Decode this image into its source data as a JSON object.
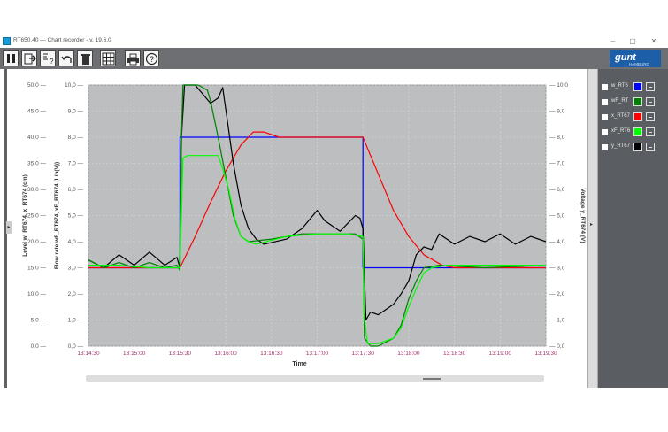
{
  "window": {
    "title": "RT650.40  —  Chart recorder - v. 19.6.0",
    "controls": [
      "minimize",
      "maximize",
      "close"
    ]
  },
  "toolbar": {
    "buttons": [
      "pause",
      "export",
      "settings-help",
      "undo",
      "delete",
      "grid",
      "print",
      "help"
    ],
    "logo_text": "gunt",
    "logo_subtext": "HAMBURG"
  },
  "legend": [
    {
      "label": "w_RT6",
      "color": "#0000ff"
    },
    {
      "label": "wF_RT",
      "color": "#008000"
    },
    {
      "label": "x_RT67",
      "color": "#ff0000"
    },
    {
      "label": "xF_RT6",
      "color": "#00ff00"
    },
    {
      "label": "y_RT67",
      "color": "#000000"
    }
  ],
  "chart_data": {
    "type": "line",
    "xlabel": "Time",
    "x_ticks": [
      "13:14:30",
      "13:15:00",
      "13:15:30",
      "13:16:00",
      "13:16:30",
      "13:17:00",
      "13:17:30",
      "13:18:00",
      "13:18:30",
      "13:19:00",
      "13:19:30"
    ],
    "x_range_seconds": [
      0,
      300
    ],
    "y_axes": [
      {
        "label": "Level  w_RT674, x_RT674   (cm)",
        "ticks": [
          "0,0",
          "5,0",
          "10,0",
          "15,0",
          "20,0",
          "25,0",
          "30,0",
          "35,0",
          "40,0",
          "45,0",
          "50,0"
        ],
        "range": [
          0,
          50
        ]
      },
      {
        "label": "Flow rate  wF_RT674, xF_RT674   (L/h(V))",
        "ticks": [
          "0,0",
          "1,0",
          "2,0",
          "3,0",
          "4,0",
          "5,0",
          "6,0",
          "7,0",
          "8,0",
          "9,0",
          "10,0"
        ],
        "range": [
          0,
          10
        ]
      },
      {
        "label": "Voltage  y_RT674   (V)",
        "ticks": [
          "0,0",
          "1,0",
          "2,0",
          "3,0",
          "4,0",
          "5,0",
          "6,0",
          "7,0",
          "8,0",
          "9,0",
          "10,0"
        ],
        "range": [
          0,
          10
        ]
      }
    ],
    "grid": true,
    "series": [
      {
        "name": "w_RT6",
        "color": "#0000ff",
        "points": [
          [
            0,
            3.0
          ],
          [
            60,
            3.0
          ],
          [
            60,
            8.0
          ],
          [
            180,
            8.0
          ],
          [
            180,
            3.0
          ],
          [
            300,
            3.0
          ]
        ]
      },
      {
        "name": "x_RT67",
        "color": "#ff0000",
        "points": [
          [
            0,
            3.0
          ],
          [
            60,
            3.0
          ],
          [
            70,
            4.2
          ],
          [
            80,
            5.5
          ],
          [
            90,
            6.7
          ],
          [
            100,
            7.7
          ],
          [
            108,
            8.2
          ],
          [
            115,
            8.2
          ],
          [
            125,
            8.0
          ],
          [
            180,
            8.0
          ],
          [
            190,
            6.6
          ],
          [
            200,
            5.2
          ],
          [
            210,
            4.2
          ],
          [
            220,
            3.5
          ],
          [
            232,
            3.1
          ],
          [
            240,
            3.0
          ],
          [
            300,
            3.0
          ]
        ]
      },
      {
        "name": "y_RT67",
        "color": "#000000",
        "points": [
          [
            0,
            3.3
          ],
          [
            10,
            3.0
          ],
          [
            20,
            3.5
          ],
          [
            30,
            3.1
          ],
          [
            40,
            3.6
          ],
          [
            50,
            3.1
          ],
          [
            58,
            3.4
          ],
          [
            60,
            3.0
          ],
          [
            61,
            8.0
          ],
          [
            63,
            10.0
          ],
          [
            70,
            10.0
          ],
          [
            80,
            9.3
          ],
          [
            85,
            9.5
          ],
          [
            88,
            9.9
          ],
          [
            95,
            7.0
          ],
          [
            100,
            5.4
          ],
          [
            105,
            4.5
          ],
          [
            110,
            4.1
          ],
          [
            115,
            3.9
          ],
          [
            130,
            4.1
          ],
          [
            140,
            4.5
          ],
          [
            150,
            5.2
          ],
          [
            155,
            4.8
          ],
          [
            160,
            4.6
          ],
          [
            165,
            4.4
          ],
          [
            170,
            4.7
          ],
          [
            175,
            5.0
          ],
          [
            178,
            4.9
          ],
          [
            180,
            4.5
          ],
          [
            182,
            1.0
          ],
          [
            185,
            1.3
          ],
          [
            190,
            1.2
          ],
          [
            195,
            1.4
          ],
          [
            200,
            1.6
          ],
          [
            205,
            2.0
          ],
          [
            210,
            2.5
          ],
          [
            215,
            3.5
          ],
          [
            220,
            3.8
          ],
          [
            225,
            3.7
          ],
          [
            230,
            4.3
          ],
          [
            240,
            3.9
          ],
          [
            250,
            4.2
          ],
          [
            260,
            4.0
          ],
          [
            270,
            4.3
          ],
          [
            280,
            3.9
          ],
          [
            290,
            4.2
          ],
          [
            300,
            4.0
          ]
        ]
      },
      {
        "name": "wF_RT",
        "color": "#008000",
        "points": [
          [
            0,
            3.3
          ],
          [
            10,
            3.0
          ],
          [
            20,
            3.2
          ],
          [
            30,
            3.0
          ],
          [
            40,
            3.2
          ],
          [
            50,
            3.0
          ],
          [
            58,
            3.1
          ],
          [
            60,
            2.9
          ],
          [
            61,
            8.0
          ],
          [
            62,
            10.0
          ],
          [
            72,
            10.0
          ],
          [
            78,
            9.8
          ],
          [
            80,
            9.4
          ],
          [
            85,
            8.0
          ],
          [
            90,
            6.5
          ],
          [
            95,
            5.0
          ],
          [
            100,
            4.2
          ],
          [
            105,
            4.0
          ],
          [
            120,
            4.1
          ],
          [
            140,
            4.3
          ],
          [
            160,
            4.3
          ],
          [
            175,
            4.3
          ],
          [
            180,
            4.1
          ],
          [
            181,
            0.3
          ],
          [
            185,
            0.0
          ],
          [
            190,
            0.0
          ],
          [
            200,
            0.3
          ],
          [
            205,
            0.8
          ],
          [
            210,
            1.8
          ],
          [
            215,
            2.5
          ],
          [
            220,
            3.0
          ],
          [
            230,
            3.1
          ],
          [
            260,
            3.0
          ],
          [
            300,
            3.1
          ]
        ]
      },
      {
        "name": "xF_RT6",
        "color": "#00ff00",
        "points": [
          [
            0,
            3.1
          ],
          [
            20,
            3.1
          ],
          [
            40,
            3.0
          ],
          [
            58,
            3.0
          ],
          [
            60,
            3.0
          ],
          [
            62,
            7.2
          ],
          [
            65,
            7.3
          ],
          [
            85,
            7.3
          ],
          [
            88,
            6.8
          ],
          [
            92,
            6.0
          ],
          [
            96,
            4.9
          ],
          [
            100,
            4.2
          ],
          [
            105,
            4.0
          ],
          [
            110,
            3.9
          ],
          [
            130,
            4.2
          ],
          [
            150,
            4.3
          ],
          [
            170,
            4.3
          ],
          [
            180,
            4.2
          ],
          [
            181,
            1.0
          ],
          [
            183,
            0.1
          ],
          [
            190,
            0.1
          ],
          [
            200,
            0.3
          ],
          [
            205,
            0.7
          ],
          [
            210,
            1.5
          ],
          [
            215,
            2.2
          ],
          [
            220,
            2.8
          ],
          [
            225,
            3.0
          ],
          [
            235,
            3.1
          ],
          [
            260,
            3.1
          ],
          [
            300,
            3.1
          ]
        ]
      }
    ]
  }
}
